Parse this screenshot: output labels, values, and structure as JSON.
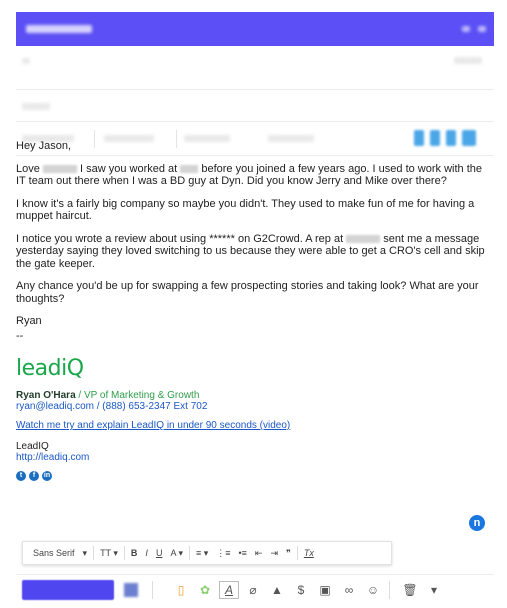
{
  "body": {
    "greeting": "Hey Jason,",
    "p1_a": "Love",
    "p1_b": "I saw you worked at",
    "p1_c": "before you joined a few years ago. I used to work with the IT team out there when I was  a BD guy at Dyn. Did you know Jerry and Mike over there?",
    "p2": "I know it's a fairly big company so maybe you didn't. They used to make fun of me for having a muppet haircut.",
    "p3_a": "I notice you wrote a review about using ****** on G2Crowd. A rep at",
    "p3_b": "sent me a message yesterday saying they loved switching to us because they were able to get a CRO's cell and skip the gate keeper.",
    "p4": "Any chance you'd be up for swapping a few prospecting stories and taking look? What are your thoughts?",
    "signoff": "Ryan",
    "dashes": "--"
  },
  "signature": {
    "logo_text": "leadiQ",
    "name": "Ryan O'Hara",
    "role": " / VP of Marketing & Growth",
    "email": "ryan@leadiq.com",
    "phone": " / (888) 653-2347 Ext 702",
    "video_link": "Watch me try and explain LeadIQ in under 90 seconds (video)",
    "company": "LeadIQ",
    "website": "http://leadiq.com",
    "socials": [
      {
        "icon": "twitter-icon",
        "glyph": "t"
      },
      {
        "icon": "facebook-icon",
        "glyph": "f"
      },
      {
        "icon": "linkedin-icon",
        "glyph": "in"
      }
    ]
  },
  "format_toolbar": {
    "font": "Sans Serif",
    "items": [
      "▾",
      "TT ▾",
      "B",
      "I",
      "U",
      "A ▾",
      "≡ ▾",
      "⋮≡",
      "•≡",
      "⇤",
      "⇥",
      "❞",
      "Tx"
    ]
  },
  "colors": {
    "header": "#5b4ff5",
    "send": "#4f46f0",
    "link": "#1a57c6",
    "brand_green": "#1aa64a"
  },
  "float_button": "n"
}
